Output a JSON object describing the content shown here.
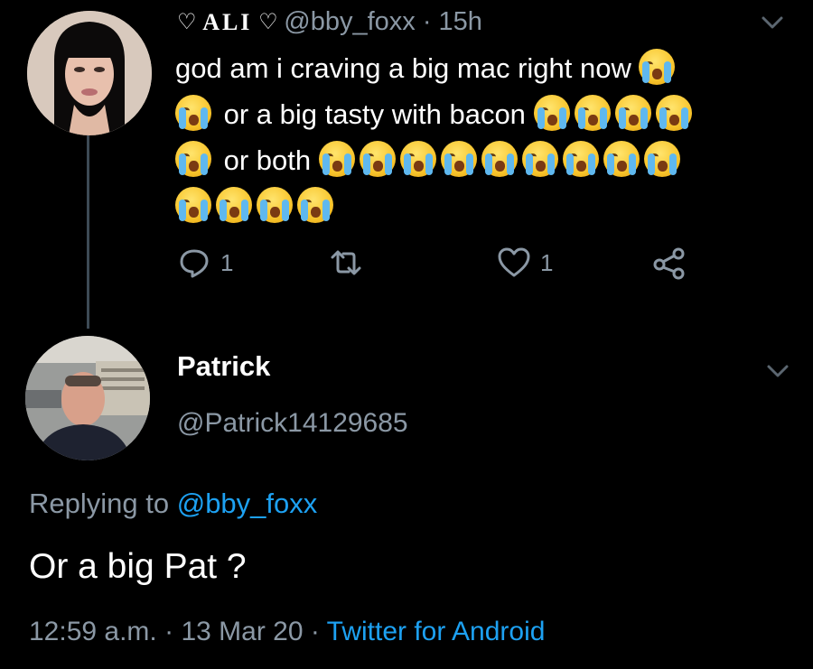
{
  "tweet": {
    "display_name": "ALI",
    "handle": "@bby_foxx",
    "separator": "·",
    "time": "15h",
    "text_line1": "god am i craving a big mac right now",
    "text_line2": "or a big tasty with bacon",
    "text_line3": "or both",
    "emoji": "loudly-crying-face",
    "reply_count": "1",
    "like_count": "1"
  },
  "reply": {
    "name": "Patrick",
    "handle": "@Patrick14129685",
    "replying_prefix": "Replying to",
    "replying_to": "@bby_foxx",
    "text": "Or a big Pat ?",
    "time": "12:59 a.m.",
    "separator1": "·",
    "date": "13 Mar 20",
    "separator2": "·",
    "source": "Twitter for Android"
  },
  "colors": {
    "background": "#000000",
    "secondary_text": "#8b98a5",
    "link": "#1da1f2",
    "thread_line": "#3d4a55"
  }
}
